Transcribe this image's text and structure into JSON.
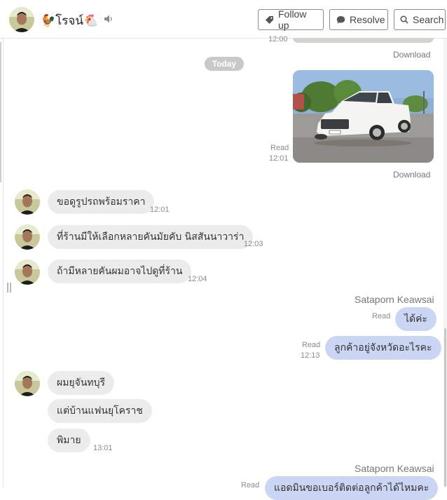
{
  "header": {
    "contact_name": "🐓โรจน์🐔",
    "buttons": {
      "follow_up": "Follow up",
      "resolve": "Resolve",
      "search": "Search"
    }
  },
  "chat": {
    "prev_time": "12:00",
    "download_label": "Download",
    "date_divider": "Today",
    "photo_message": {
      "read": "Read",
      "time": "12:01"
    },
    "incoming_1": [
      {
        "text": "ขอดูรูปรถพร้อมราคา",
        "time": "12:01"
      },
      {
        "text": "ที่ร้านมีให้เลือกหลายคันมัยคับ นิสสันนาวาร่า",
        "time": "12:03"
      },
      {
        "text": "ถ้ามีหลายคันผมอาจไปดูที่ร้าน",
        "time": "12:04"
      }
    ],
    "agent_name": "Sataporn Keawsai",
    "outgoing_1": [
      {
        "text": "ได้ค่ะ",
        "read": "Read",
        "time": ""
      },
      {
        "text": "ลูกค้าอยู่จังหวัดอะไรคะ",
        "read": "Read",
        "time": "12:13"
      }
    ],
    "incoming_2": [
      {
        "text": "ผมยุจันทบุรี",
        "time": ""
      },
      {
        "text": "แต่บ้านแฟนยุโคราช",
        "time": ""
      },
      {
        "text": "พิมาย",
        "time": "13:01"
      }
    ],
    "agent_name_2": "Sataporn Keawsai",
    "outgoing_2": {
      "text": "แอดมินขอเบอร์ติดต่อลูกค้าได้ไหมคะ",
      "read": "Read"
    }
  }
}
